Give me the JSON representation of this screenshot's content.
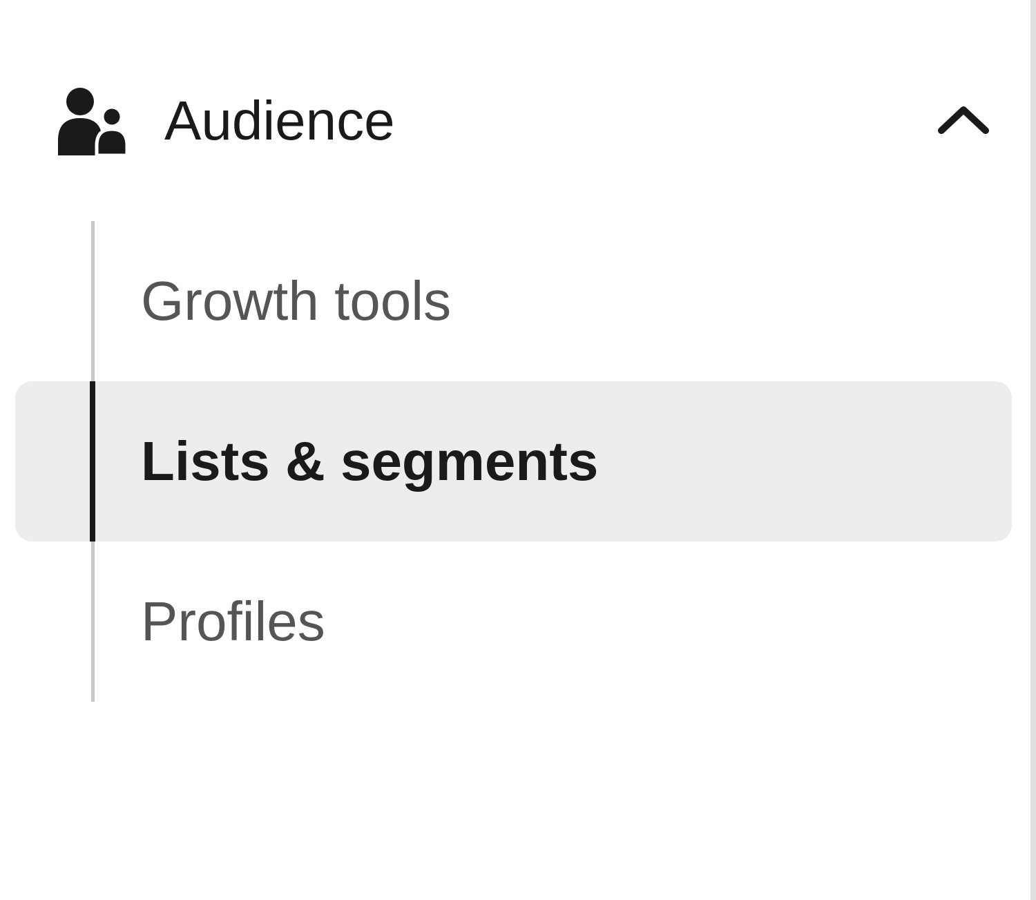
{
  "sidebar": {
    "section": {
      "label": "Audience",
      "expanded": true,
      "items": [
        {
          "label": "Growth tools",
          "active": false
        },
        {
          "label": "Lists & segments",
          "active": true
        },
        {
          "label": "Profiles",
          "active": false
        }
      ]
    }
  }
}
